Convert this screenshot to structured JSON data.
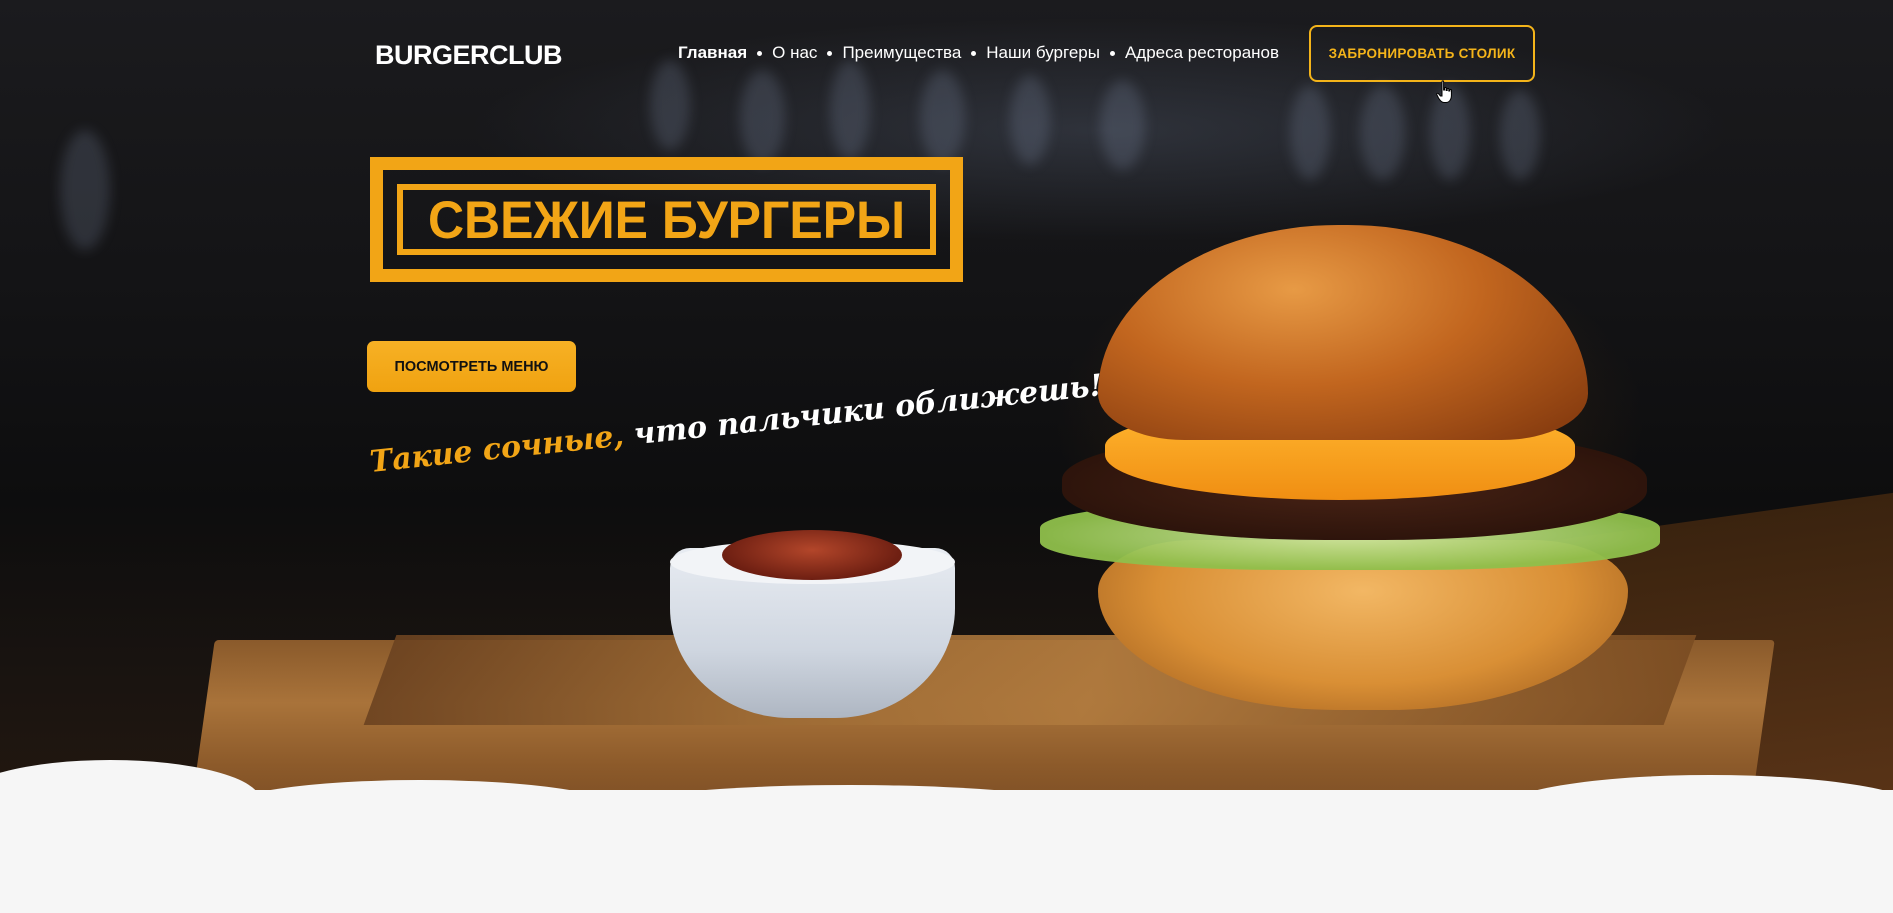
{
  "header": {
    "logo": "BURGERCLUB",
    "nav": [
      {
        "label": "Главная",
        "active": true
      },
      {
        "label": "О нас",
        "active": false
      },
      {
        "label": "Преимущества",
        "active": false
      },
      {
        "label": "Наши бургеры",
        "active": false
      },
      {
        "label": "Адреса ресторанов",
        "active": false
      }
    ],
    "book_button": "ЗАБРОНИРОВАТЬ СТОЛИК"
  },
  "hero": {
    "title": "СВЕЖИЕ БУРГЕРЫ",
    "menu_button": "ПОСМОТРЕТЬ МЕНЮ",
    "slogan_accent": "Такие сочные,",
    "slogan_rest": " что пальчики оближешь!"
  },
  "colors": {
    "accent": "#f2a516",
    "text": "#ffffff",
    "background_dark": "#141416",
    "page_bottom": "#f6f6f6"
  },
  "icons": {
    "cursor": "hand-pointer-icon"
  }
}
